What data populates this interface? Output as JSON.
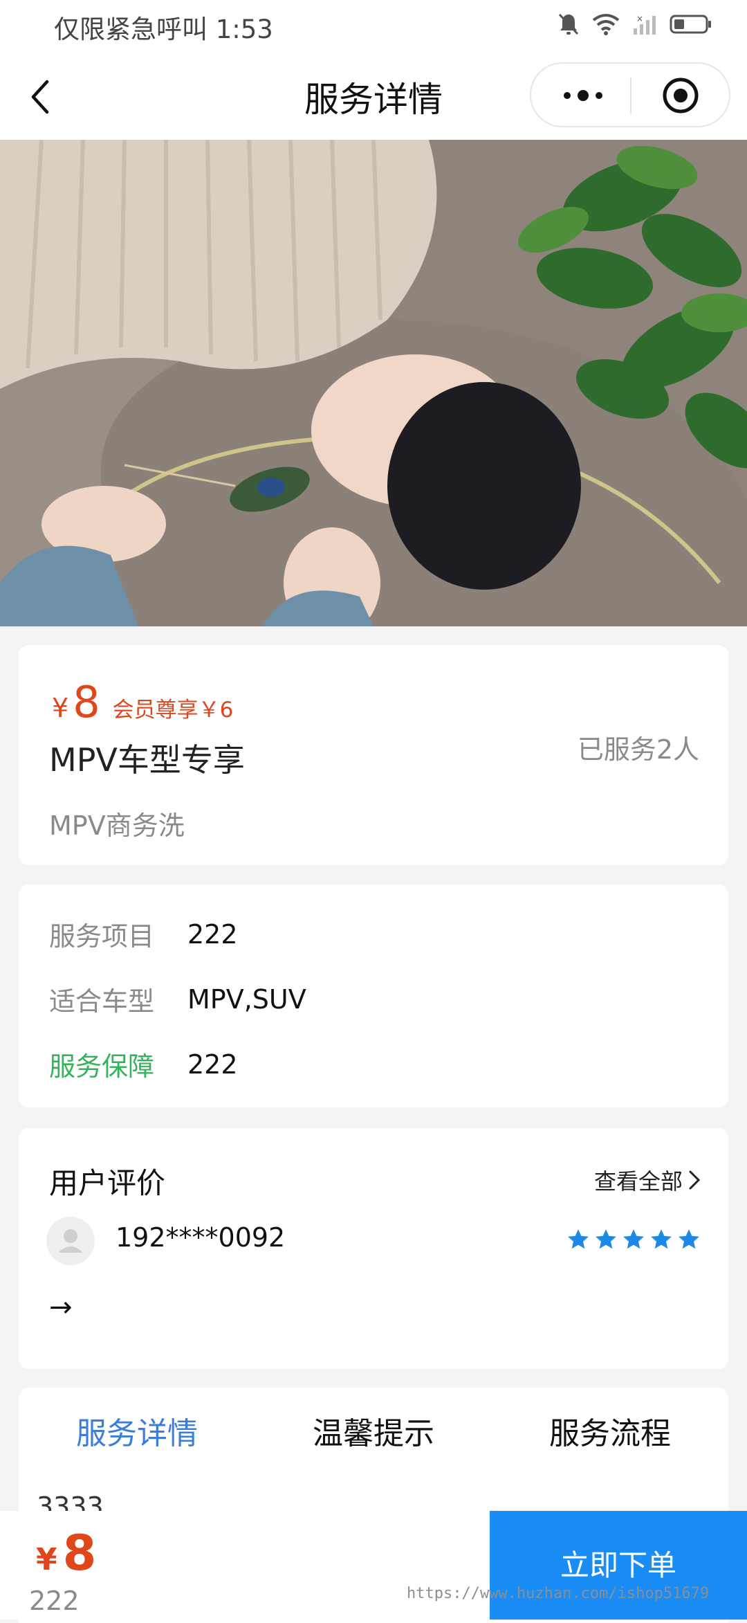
{
  "status_bar": {
    "time": "仅限紧急呼叫 1:53",
    "icons": [
      "bell-muted-icon",
      "wifi-icon",
      "signal-icon",
      "battery-icon"
    ]
  },
  "nav": {
    "title": "服务详情",
    "icons": [
      "back-arrow-icon",
      "more-dots-icon",
      "close-target-icon"
    ]
  },
  "price_card": {
    "currency": "¥",
    "price": "8",
    "member_price": "会员尊享￥6",
    "service_name": "MPV车型专享",
    "served": "已服务2人",
    "subtitle": "MPV商务洗"
  },
  "info_card": {
    "rows": [
      {
        "key": "服务项目",
        "value": "222"
      },
      {
        "key": "适合车型",
        "value": "MPV,SUV"
      },
      {
        "key": "服务保障",
        "value": "222"
      }
    ]
  },
  "review": {
    "title": "用户评价",
    "view_all": "查看全部",
    "user": "192****0092",
    "rating": 5,
    "content": "→"
  },
  "tabs": {
    "items": [
      "服务详情",
      "温馨提示",
      "服务流程"
    ],
    "active": 0,
    "content": "3333"
  },
  "bottom": {
    "currency": "¥",
    "price": "8",
    "sub": "222",
    "button": "立即下单",
    "watermark": "https://www.huzhan.com/ishop51679"
  },
  "colors": {
    "price_red": "#e0461c",
    "accent_blue": "#1a8cf6",
    "tab_active": "#3b7ddd",
    "guarantee_green": "#33b45a",
    "star_blue": "#1e88e5"
  }
}
